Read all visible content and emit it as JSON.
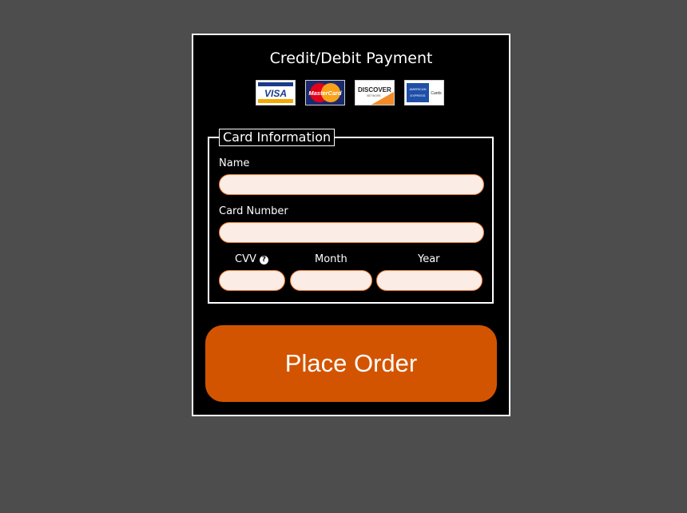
{
  "payment": {
    "title": "Credit/Debit Payment",
    "card_logos": [
      "visa-logo",
      "mastercard-logo",
      "discover-logo",
      "american-express-logo"
    ],
    "card_logo_text": {
      "visa": "VISA",
      "mastercard": "MasterCard",
      "discover": "DISCOVER",
      "discover_sub": "NETWORK",
      "amex_top": "AMERICAN",
      "amex_mid": "EXPRESS",
      "amex_right": "Cards"
    },
    "fieldset_legend": "Card Information",
    "fields": {
      "name": {
        "label": "Name",
        "value": "",
        "placeholder": ""
      },
      "card_number": {
        "label": "Card Number",
        "value": "",
        "placeholder": ""
      },
      "cvv": {
        "label": "CVV",
        "value": "",
        "placeholder": "",
        "help_icon": "question-circle-icon"
      },
      "month": {
        "label": "Month",
        "value": "",
        "placeholder": ""
      },
      "year": {
        "label": "Year",
        "value": "",
        "placeholder": ""
      }
    },
    "submit_label": "Place Order"
  },
  "colors": {
    "background": "#4d4d4d",
    "panel": "#000000",
    "accent": "#d35400",
    "input_fill": "#fbece6",
    "input_border": "#f0803a"
  }
}
